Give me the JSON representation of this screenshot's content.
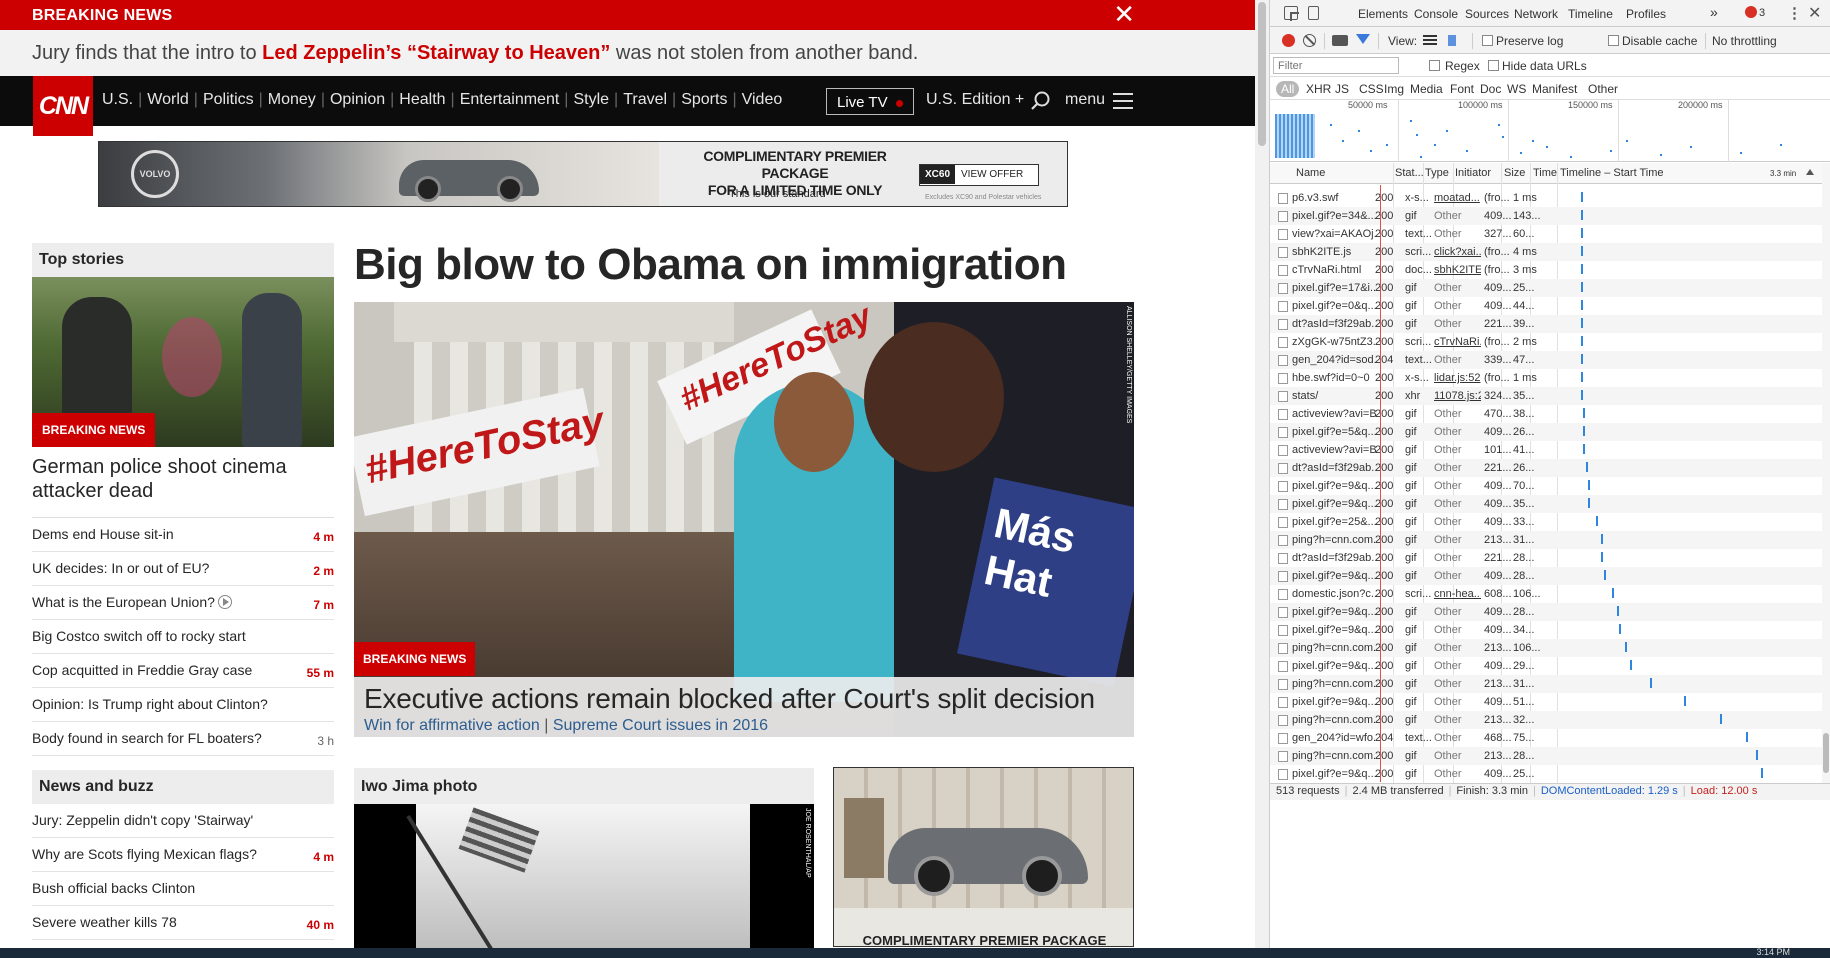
{
  "breaking": {
    "label": "BREAKING NEWS",
    "close": "✕"
  },
  "teaser": {
    "pre": "Jury finds that the intro to ",
    "highlight": "Led Zeppelin’s “Stairway to Heaven”",
    "post": " was not stolen from another band."
  },
  "nav": {
    "logo": "CNN",
    "links": [
      "U.S.",
      "World",
      "Politics",
      "Money",
      "Opinion",
      "Health",
      "Entertainment",
      "Style",
      "Travel",
      "Sports",
      "Video"
    ],
    "live_tv": "Live TV",
    "edition": "U.S. Edition +",
    "menu": "menu"
  },
  "top_ad": {
    "brand": "VOLVO",
    "line1": "COMPLIMENTARY PREMIER PACKAGE",
    "line2": "FOR A LIMITED TIME ONLY",
    "line3": "This is our standard",
    "model": "XC60",
    "cta": "VIEW OFFER",
    "fine": "Excludes XC90 and Polestar vehicles"
  },
  "sidebar": {
    "top_stories_title": "Top stories",
    "photo_tag": "BREAKING NEWS",
    "photo_headline": "German police shoot cinema attacker dead",
    "stories": [
      {
        "title": "Dems end House sit-in",
        "time": "4 m",
        "red": true
      },
      {
        "title": "UK decides: In or out of EU?",
        "time": "2 m",
        "red": true
      },
      {
        "title": "What is the European Union?",
        "time": "7 m",
        "red": true,
        "video": true
      },
      {
        "title": "Big Costco switch off to rocky start",
        "time": "",
        "red": false
      },
      {
        "title": "Cop acquitted in Freddie Gray case",
        "time": "55 m",
        "red": true
      },
      {
        "title": "Opinion: Is Trump right about Clinton?",
        "time": "",
        "red": false
      },
      {
        "title": "Body found in search for FL boaters?",
        "time": "3 h",
        "red": false
      }
    ],
    "buzz_title": "News and buzz",
    "buzz": [
      {
        "title": "Jury: Zeppelin didn't copy 'Stairway'",
        "time": "",
        "red": false
      },
      {
        "title": "Why are Scots flying Mexican flags?",
        "time": "4 m",
        "red": true
      },
      {
        "title": "Bush official backs Clinton",
        "time": "",
        "red": false
      },
      {
        "title": "Severe weather kills 78",
        "time": "40 m",
        "red": true
      }
    ]
  },
  "main": {
    "title": "Big blow to Obama on immigration",
    "hero_tag": "BREAKING NEWS",
    "hero_signs": [
      "#HereToStay",
      "#HereToStay"
    ],
    "hero_sign3": "Más Hat",
    "hero_credit": "ALLISON SHELLEY/GETTY IMAGES",
    "hero_headline": "Executive actions remain blocked after Court's split decision",
    "hero_sub1": "Win for affirmative action",
    "hero_sub2": "Supreme Court issues in 2016",
    "iwo_title": "Iwo Jima photo",
    "iwo_credit": "JOE ROSENTHAL/AP",
    "ad2_text": "COMPLIMENTARY PREMIER PACKAGE"
  },
  "devtools": {
    "tabs": [
      "Elements",
      "Console",
      "Sources",
      "Network",
      "Timeline",
      "Profiles"
    ],
    "active_tab": "Network",
    "more": "»",
    "error_count": "3",
    "view_label": "View:",
    "preserve_log": "Preserve log",
    "disable_cache": "Disable cache",
    "throttling": "No throttling",
    "filter_placeholder": "Filter",
    "regex": "Regex",
    "hide_data_urls": "Hide data URLs",
    "types": [
      "All",
      "XHR",
      "JS",
      "CSS",
      "Img",
      "Media",
      "Font",
      "Doc",
      "WS",
      "Manifest",
      "Other"
    ],
    "overview_ticks": [
      "50000 ms",
      "100000 ms",
      "150000 ms",
      "200000 ms"
    ],
    "columns": [
      "Name",
      "Stat...",
      "Type",
      "Initiator",
      "Size",
      "Time",
      "Timeline – Start Time"
    ],
    "timeline_end": "3.3 min",
    "rows": [
      {
        "name": "p6.v3.swf",
        "status": "200",
        "type": "x-s...",
        "initiator": "moatad...",
        "link": true,
        "size": "(fro...",
        "time": "1 ms",
        "wf": 0.08
      },
      {
        "name": "pixel.gif?e=34&...",
        "status": "200",
        "type": "gif",
        "initiator": "Other",
        "link": false,
        "size": "409...",
        "time": "143...",
        "wf": 0.08
      },
      {
        "name": "view?xai=AKAOj...",
        "status": "200",
        "type": "text...",
        "initiator": "Other",
        "link": false,
        "size": "327...",
        "time": "60...",
        "wf": 0.08
      },
      {
        "name": "sbhK2ITE.js",
        "status": "200",
        "type": "scri...",
        "initiator": "click?xai...",
        "link": true,
        "size": "(fro...",
        "time": "4 ms",
        "wf": 0.08
      },
      {
        "name": "cTrvNaRi.html",
        "status": "200",
        "type": "doc...",
        "initiator": "sbhK2ITE...",
        "link": true,
        "size": "(fro...",
        "time": "3 ms",
        "wf": 0.08
      },
      {
        "name": "pixel.gif?e=17&i...",
        "status": "200",
        "type": "gif",
        "initiator": "Other",
        "link": false,
        "size": "409...",
        "time": "25...",
        "wf": 0.08
      },
      {
        "name": "pixel.gif?e=0&q...",
        "status": "200",
        "type": "gif",
        "initiator": "Other",
        "link": false,
        "size": "409...",
        "time": "44...",
        "wf": 0.08
      },
      {
        "name": "dt?asId=f3f29ab...",
        "status": "200",
        "type": "gif",
        "initiator": "Other",
        "link": false,
        "size": "221...",
        "time": "39...",
        "wf": 0.08
      },
      {
        "name": "zXgGK-w75ntZ3...",
        "status": "200",
        "type": "scri...",
        "initiator": "cTrvNaRi...",
        "link": true,
        "size": "(fro...",
        "time": "2 ms",
        "wf": 0.08
      },
      {
        "name": "gen_204?id=sod...",
        "status": "204",
        "type": "text...",
        "initiator": "Other",
        "link": false,
        "size": "339...",
        "time": "47...",
        "wf": 0.08
      },
      {
        "name": "hbe.swf?id=0~0",
        "status": "200",
        "type": "x-s...",
        "initiator": "lidar.js:52",
        "link": true,
        "size": "(fro...",
        "time": "1 ms",
        "wf": 0.08
      },
      {
        "name": "stats/",
        "status": "200",
        "type": "xhr",
        "initiator": "11078.js:2",
        "link": true,
        "size": "324...",
        "time": "35...",
        "wf": 0.08
      },
      {
        "name": "activeview?avi=B...",
        "status": "200",
        "type": "gif",
        "initiator": "Other",
        "link": false,
        "size": "470...",
        "time": "38...",
        "wf": 0.09
      },
      {
        "name": "pixel.gif?e=5&q...",
        "status": "200",
        "type": "gif",
        "initiator": "Other",
        "link": false,
        "size": "409...",
        "time": "26...",
        "wf": 0.09
      },
      {
        "name": "activeview?avi=B...",
        "status": "200",
        "type": "gif",
        "initiator": "Other",
        "link": false,
        "size": "101...",
        "time": "41...",
        "wf": 0.09
      },
      {
        "name": "dt?asId=f3f29ab...",
        "status": "200",
        "type": "gif",
        "initiator": "Other",
        "link": false,
        "size": "221...",
        "time": "26...",
        "wf": 0.1
      },
      {
        "name": "pixel.gif?e=9&q...",
        "status": "200",
        "type": "gif",
        "initiator": "Other",
        "link": false,
        "size": "409...",
        "time": "70...",
        "wf": 0.11
      },
      {
        "name": "pixel.gif?e=9&q...",
        "status": "200",
        "type": "gif",
        "initiator": "Other",
        "link": false,
        "size": "409...",
        "time": "35...",
        "wf": 0.11
      },
      {
        "name": "pixel.gif?e=25&...",
        "status": "200",
        "type": "gif",
        "initiator": "Other",
        "link": false,
        "size": "409...",
        "time": "33...",
        "wf": 0.14
      },
      {
        "name": "ping?h=cnn.com...",
        "status": "200",
        "type": "gif",
        "initiator": "Other",
        "link": false,
        "size": "213...",
        "time": "31...",
        "wf": 0.16
      },
      {
        "name": "dt?asId=f3f29ab...",
        "status": "200",
        "type": "gif",
        "initiator": "Other",
        "link": false,
        "size": "221...",
        "time": "28...",
        "wf": 0.16
      },
      {
        "name": "pixel.gif?e=9&q...",
        "status": "200",
        "type": "gif",
        "initiator": "Other",
        "link": false,
        "size": "409...",
        "time": "28...",
        "wf": 0.17
      },
      {
        "name": "domestic.json?c...",
        "status": "200",
        "type": "scri...",
        "initiator": "cnn-hea...",
        "link": true,
        "size": "608...",
        "time": "106...",
        "wf": 0.2
      },
      {
        "name": "pixel.gif?e=9&q...",
        "status": "200",
        "type": "gif",
        "initiator": "Other",
        "link": false,
        "size": "409...",
        "time": "28...",
        "wf": 0.22
      },
      {
        "name": "pixel.gif?e=9&q...",
        "status": "200",
        "type": "gif",
        "initiator": "Other",
        "link": false,
        "size": "409...",
        "time": "34...",
        "wf": 0.23
      },
      {
        "name": "ping?h=cnn.com...",
        "status": "200",
        "type": "gif",
        "initiator": "Other",
        "link": false,
        "size": "213...",
        "time": "106...",
        "wf": 0.25
      },
      {
        "name": "pixel.gif?e=9&q...",
        "status": "200",
        "type": "gif",
        "initiator": "Other",
        "link": false,
        "size": "409...",
        "time": "29...",
        "wf": 0.27
      },
      {
        "name": "ping?h=cnn.com...",
        "status": "200",
        "type": "gif",
        "initiator": "Other",
        "link": false,
        "size": "213...",
        "time": "31...",
        "wf": 0.35
      },
      {
        "name": "pixel.gif?e=9&q...",
        "status": "200",
        "type": "gif",
        "initiator": "Other",
        "link": false,
        "size": "409...",
        "time": "51...",
        "wf": 0.48
      },
      {
        "name": "ping?h=cnn.com...",
        "status": "200",
        "type": "gif",
        "initiator": "Other",
        "link": false,
        "size": "213...",
        "time": "32...",
        "wf": 0.62
      },
      {
        "name": "gen_204?id=wfo...",
        "status": "204",
        "type": "text...",
        "initiator": "Other",
        "link": false,
        "size": "468...",
        "time": "75...",
        "wf": 0.72
      },
      {
        "name": "ping?h=cnn.com...",
        "status": "200",
        "type": "gif",
        "initiator": "Other",
        "link": false,
        "size": "213...",
        "time": "28...",
        "wf": 0.76
      },
      {
        "name": "pixel.gif?e=9&q...",
        "status": "200",
        "type": "gif",
        "initiator": "Other",
        "link": false,
        "size": "409...",
        "time": "25...",
        "wf": 0.78
      }
    ],
    "status": {
      "requests": "513 requests",
      "transferred": "2.4 MB transferred",
      "finish": "Finish: 3.3 min",
      "dcl": "DOMContentLoaded: 1.29 s",
      "load": "Load: 12.00 s"
    }
  },
  "taskbar": {
    "clock": "3:14 PM"
  }
}
